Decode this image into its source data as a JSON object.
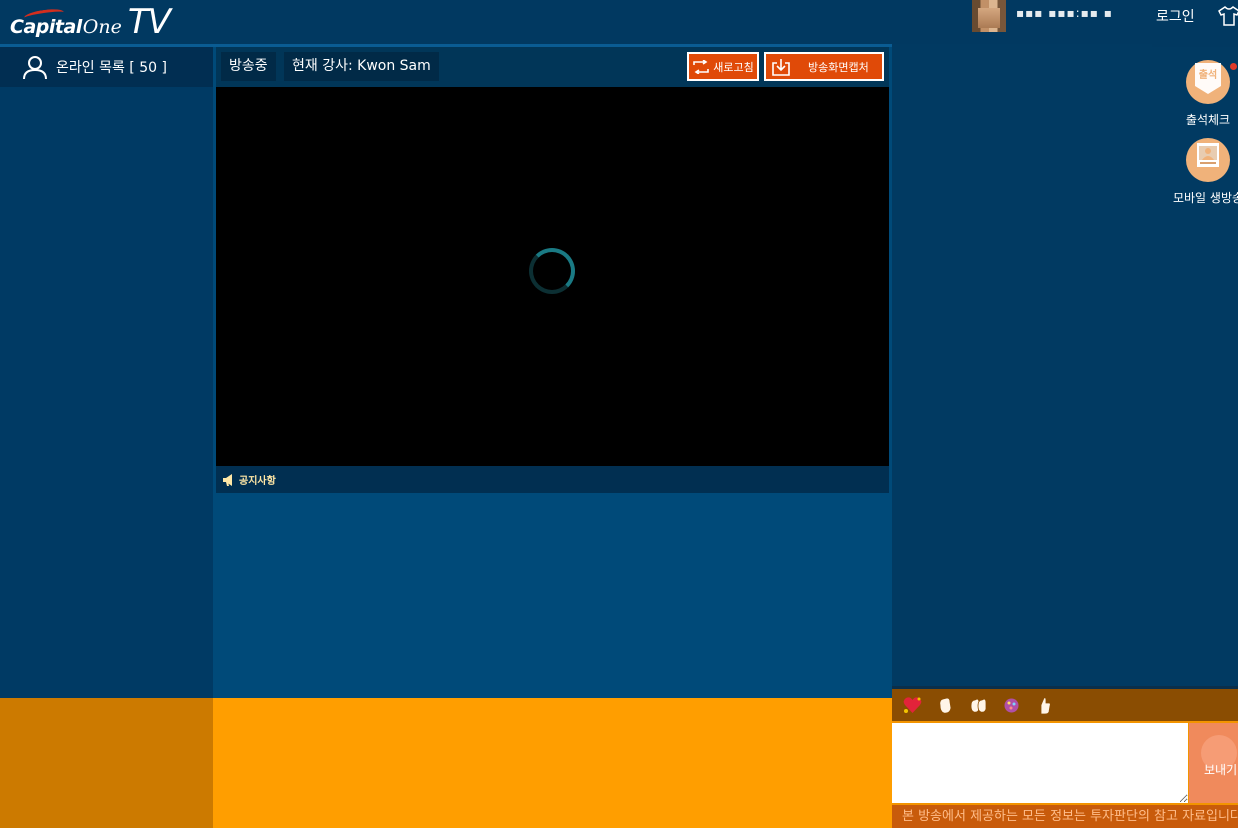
{
  "header": {
    "logo": {
      "capital": "Capital",
      "one": "One",
      "tv": "TV"
    },
    "username": "▪▪▪ ▪▪▪:▪▪ ▪",
    "login_label": "로그인"
  },
  "sidebar": {
    "online_list_label": "온라인 목록 [ 50 ]"
  },
  "player": {
    "status": "방송중",
    "teacher": "현재 강사:  Kwon Sam",
    "refresh_label": "새로고침",
    "capture_label": "방송화면캡처",
    "notice_label": "공지사항"
  },
  "side_menu": {
    "attendance_badge": "출석",
    "attendance_label": "출석체크",
    "mobile_label": "모바일 생방송"
  },
  "chat": {
    "send_label": "보내기",
    "disclaimer": "본 방송에서 제공하는 모든 정보는 투자판단의 참고 자료입니다"
  },
  "colors": {
    "accent_orange": "#e04a08",
    "navy": "#003a63",
    "bottom_orange": "#ff9e00"
  }
}
